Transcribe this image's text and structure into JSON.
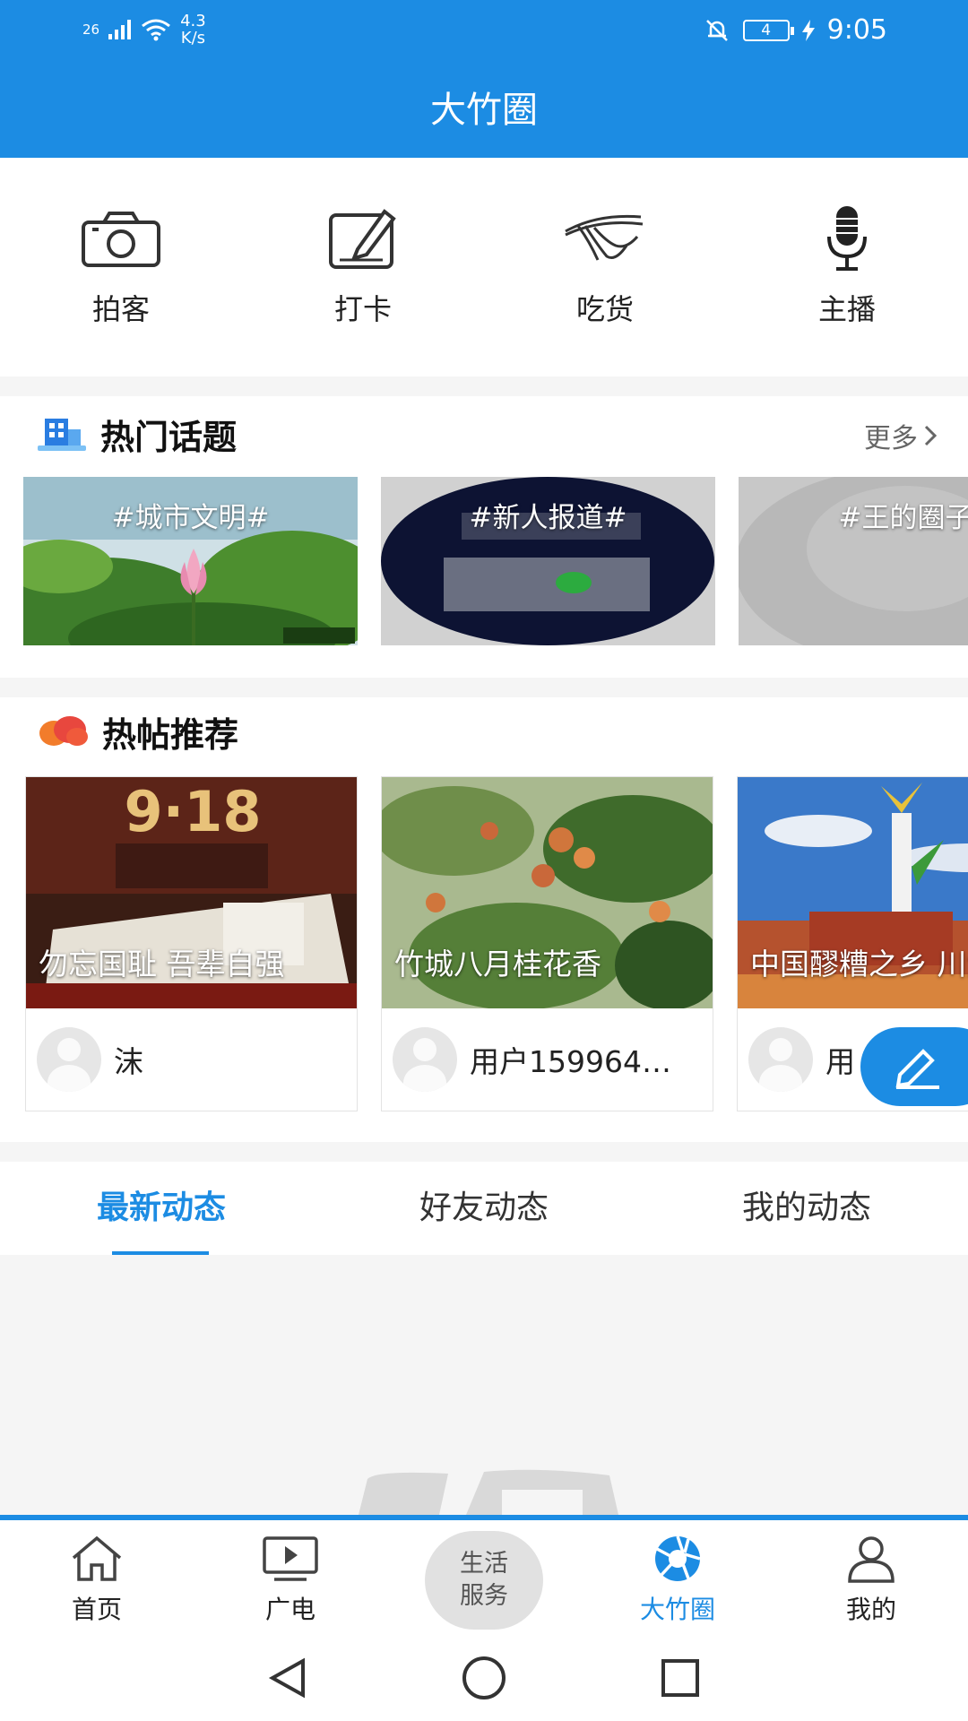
{
  "status_bar": {
    "network": "26",
    "speed_value": "4.3",
    "speed_unit": "K/s",
    "battery": "4",
    "time": "9:05"
  },
  "header": {
    "title": "大竹圈"
  },
  "quick_actions": [
    {
      "label": "拍客",
      "icon": "camera-icon"
    },
    {
      "label": "打卡",
      "icon": "edit-note-icon"
    },
    {
      "label": "吃货",
      "icon": "noodles-icon"
    },
    {
      "label": "主播",
      "icon": "microphone-icon"
    }
  ],
  "hot_topics": {
    "title": "热门话题",
    "more_label": "更多",
    "items": [
      {
        "text": "#城市文明#"
      },
      {
        "text": "#新人报道#"
      },
      {
        "text": "#王的圈子"
      }
    ]
  },
  "hot_posts": {
    "title": "热帖推荐",
    "items": [
      {
        "caption": "勿忘国耻 吾辈自强",
        "user": "沫"
      },
      {
        "caption": "竹城八月桂花香",
        "user": "用户159964…"
      },
      {
        "caption": "中国醪糟之乡 川大竹。",
        "user": "用"
      }
    ]
  },
  "feed_tabs": [
    {
      "label": "最新动态",
      "active": true
    },
    {
      "label": "好友动态",
      "active": false
    },
    {
      "label": "我的动态",
      "active": false
    }
  ],
  "bottom_nav": {
    "items": [
      {
        "label": "首页",
        "icon": "home-icon"
      },
      {
        "label": "广电",
        "icon": "tv-play-icon"
      },
      {
        "label": "大竹圈",
        "icon": "aperture-icon",
        "active": true
      },
      {
        "label": "我的",
        "icon": "user-icon"
      }
    ],
    "center": {
      "line1": "生活",
      "line2": "服务"
    }
  },
  "colors": {
    "accent": "#1c8ce3",
    "background": "#f5f5f5"
  }
}
